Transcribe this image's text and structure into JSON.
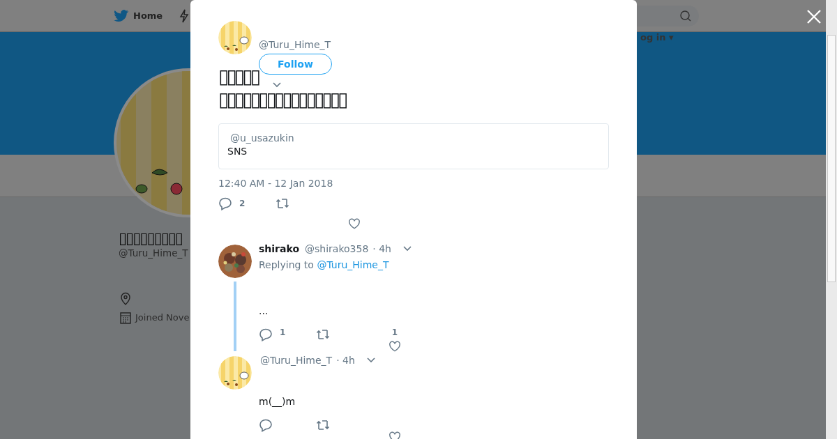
{
  "page": {
    "nav": {
      "home": "Home",
      "login": "og in ▾"
    },
    "profile": {
      "name": "▯▯▯▯▯▯▯▯▯",
      "handle": "@Turu_Hime_T",
      "joined": "Joined Nove"
    }
  },
  "tweet": {
    "handle": "@Turu_Hime_T",
    "follow": "Follow",
    "title_lines": [
      "▯▯▯▯▯",
      "▯▯▯▯▯▯▯▯▯▯▯▯▯▯▯▯"
    ],
    "quote": {
      "handle": "@u_usazukin",
      "text": "SNS"
    },
    "time": "12:40 AM - 12 Jan 2018",
    "reply_count": "2"
  },
  "replies": [
    {
      "name": "shirako",
      "handle": "@shirako358",
      "age": "· 4h",
      "replying_label": "Replying to",
      "replying_to": "@Turu_Hime_T",
      "text": "...",
      "reply_count": "1",
      "like_count": "1",
      "thread": true
    },
    {
      "handle": "@Turu_Hime_T",
      "age": "· 4h",
      "text": "m(__)m",
      "thread": false
    }
  ]
}
